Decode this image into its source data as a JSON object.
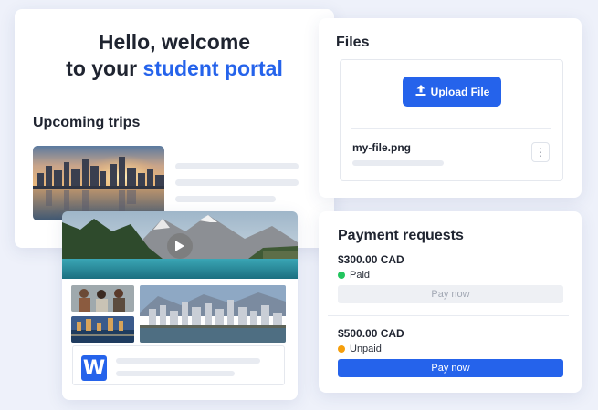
{
  "welcome": {
    "greeting_line1": "Hello, welcome",
    "greeting_line2_prefix": "to your ",
    "greeting_line2_accent": "student portal",
    "upcoming_trips_title": "Upcoming trips"
  },
  "files": {
    "title": "Files",
    "upload_label": "Upload File",
    "file_name": "my-file.png",
    "more_icon": "kebab-menu-icon"
  },
  "payments": {
    "title": "Payment requests",
    "items": [
      {
        "amount": "$300.00 CAD",
        "status": "Paid",
        "status_color": "#22c55e",
        "button_label": "Pay now",
        "button_state": "disabled"
      },
      {
        "amount": "$500.00 CAD",
        "status": "Unpaid",
        "status_color": "#f59e0b",
        "button_label": "Pay now",
        "button_state": "active"
      }
    ]
  },
  "trip_card": {
    "logo_letter": "W",
    "play_icon": "play-icon"
  },
  "colors": {
    "accent": "#2563eb",
    "background": "#eef1fa"
  }
}
